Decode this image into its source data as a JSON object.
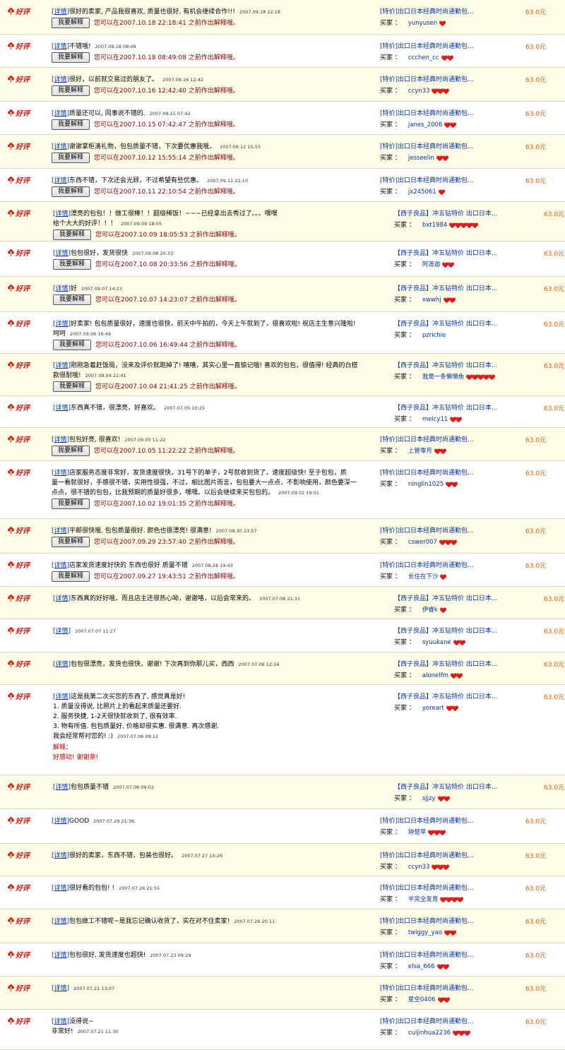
{
  "labels": {
    "rating": "好评",
    "detail": "详情",
    "explain_button": "我要解释",
    "notice_prefix": "您可以在",
    "notice_suffix": " 之前作出解释哦。",
    "buyer": "买家 ：",
    "explanation_title": "解释："
  },
  "colors": {
    "rating_red": "#e21010",
    "link_blue": "#0033aa",
    "notice_red": "#8b0000",
    "price_orange": "#e85c00",
    "row_shade": "#fffce8"
  },
  "reviews": [
    {
      "comment": "很好的卖家, 产品我很喜欢, 质量也很好, 有机会继续合作!!!",
      "date": "2007.09.18 22:18",
      "deadline": "2007.10.18 22:18:41",
      "tag": "[特价]",
      "item": "出口日本经典时尚通勤包...",
      "buyer": "yunyusen",
      "hearts": 1,
      "price": "63.0元"
    },
    {
      "comment": "不错哦!",
      "date": "2007.09.18 08:49",
      "deadline": "2007.10.18 08:49:08",
      "tag": "[特价]",
      "item": "出口日本经典时尚通勤包...",
      "buyer": "ccchen_cc",
      "hearts": 2,
      "price": "63.0元"
    },
    {
      "comment": "很好，以前就交易过的朋友了。",
      "date": "2007.09.16 12:42",
      "deadline": "2007.10.16 12:42:40",
      "tag": "[特价]",
      "item": "出口日本经典时尚通勤包...",
      "buyer": "ccyn33",
      "hearts": 3,
      "price": "63.0元"
    },
    {
      "comment": "质量还可以, 同事说不错的.",
      "date": "2007.09.15 07:42",
      "deadline": "2007.10.15 07:42:47",
      "tag": "[特价]",
      "item": "出口日本经典时尚通勤包...",
      "buyer": "janes_2006",
      "hearts": 2,
      "price": "63.0元"
    },
    {
      "comment": "谢谢掌柜滴礼物，包包质量不错，下次要优惠我哦，",
      "date": "2007.09.12 15:55",
      "deadline": "2007.10.12 15:55:14",
      "tag": "[特价]",
      "item": "出口日本经典时尚通勤包...",
      "buyer": "jesseelin",
      "hearts": 2,
      "price": "63.0元"
    },
    {
      "comment": "东西不错，下次还会光顾，不过希望有些优惠。",
      "date": "2007.09.11 22:10",
      "deadline": "2007.10.11 22:10:54",
      "tag": "[特价]",
      "item": "出口日本经典时尚通勤包...",
      "buyer": "jx245061",
      "hearts": 1,
      "price": "63.0元"
    },
    {
      "wide": true,
      "comment": "漂亮的包包！！做工很棒！！超级稀饭！~~~已经拿出去秀过了。。。嘿嘿",
      "comment2": "给个大大的好评！！！",
      "date": "2007.09.09 18:05",
      "deadline": "2007.10.09 18:05:53",
      "tag": "【西子良品】",
      "item": "冲五钻特价 出口日本...",
      "buyer": "bxt1984",
      "hearts": 5,
      "price": "63.0元"
    },
    {
      "wide": true,
      "comment": "包包很好，发货很快",
      "date": "2007.09.08 20:33",
      "deadline": "2007.10.08 20:33:56",
      "tag": "【西子良品】",
      "item": "冲五钻特价 出口日本...",
      "buyer": "阿莲迦",
      "hearts": 2,
      "price": "63.0元"
    },
    {
      "wide": true,
      "comment": "好",
      "date": "2007.09.07 14:23",
      "deadline": "2007.10.07 14:23:07",
      "tag": "【西子良品】",
      "item": "冲五钻特价 出口日本...",
      "buyer": "xwwhj",
      "hearts": 2,
      "price": "63.0元"
    },
    {
      "wide": true,
      "comment": "好卖家! 包包质量很好，速度也很快，前天中午拍的，今天上午就到了，很喜欢啦! 祝店主生意兴隆啦!",
      "comment2": "呵呵",
      "date": "2007.09.06 16:49",
      "deadline": "2007.10.06 16:49:44",
      "tag": "【西子良品】",
      "item": "冲五钻特价 出口日本...",
      "buyer": "pzrichie",
      "hearts": 0,
      "price": "63.0元"
    },
    {
      "wide": true,
      "comment": "刚刚急着赶饭局，没来及评价就跑掉了! 嘻嘻，其实心里一直惦记哦! 喜欢的包包，很值得! 经典的白搭",
      "comment2": "款很耐哦!",
      "date": "2007.09.04 21:41",
      "deadline": "2007.10.04 21:41:25",
      "tag": "【西子良品】",
      "item": "冲五钻特价 出口日本...",
      "buyer": "我是一条懒懒鱼",
      "hearts": 5,
      "price": "63.0元"
    },
    {
      "wide": true,
      "noButton": true,
      "comment": "东西真不错，很漂亮，好喜欢。",
      "date": "2007.07.05 10:25",
      "tag": "【西子良品】",
      "item": "冲五钻特价 出口日本...",
      "buyer": "meicy11",
      "hearts": 2,
      "price": "63.0元"
    },
    {
      "comment": "包包好亮, 很喜欢!",
      "date": "2007.09.05 11:22",
      "deadline": "2007.10.05 11:22:22",
      "tag": "[特价]",
      "item": "出口日本经典时尚通勤包...",
      "buyer": "上管零月",
      "hearts": 2,
      "price": "63.0元"
    },
    {
      "comment": "店家服务态度非常好，发货速度很快，31号下的单子，2号就收到货了，速度超级快! 至于包包，质",
      "comment2": "量一看就很好，手感很不错，实用性很强，不过，相比图片而言，包包要大一点点，不影响使用，颜色要深一",
      "comment3": "点点，很不错的包包，比我预期的质量好很多，嘿嘿。以后会继续来买包包的。",
      "date": "2007.09.02 19:01",
      "deadline": "2007.10.02 19:01:35",
      "tag": "[特价]",
      "item": "出口日本经典时尚通勤包...",
      "buyer": "ninglin1025",
      "hearts": 2,
      "price": "63.0元"
    },
    {
      "comment": "平邮很快哦. 包包质量很好. 颜色也很漂亮! 很满意!",
      "date": "2007.08.30 23:57",
      "deadline": "2007.09.29 23:57:40",
      "tag": "[特价]",
      "item": "出口日本经典时尚通勤包...",
      "buyer": "cswer007",
      "hearts": 3,
      "price": "63.0元"
    },
    {
      "comment": "店家发货速度好快的 东西也很好 质量不错",
      "date": "2007.08.28 19:43",
      "deadline": "2007.09.27 19:43:51",
      "tag": "[特价]",
      "item": "出口日本经典时尚通勤包...",
      "buyer": "长住在下沙",
      "hearts": 1,
      "price": "63.0元"
    },
    {
      "wide": true,
      "noButton": true,
      "comment": "东西真的好好哦，而且店主还很热心呦，谢谢咯，以后会常来的。",
      "date": "2007.07.08 21:31",
      "tag": "【西子良品】",
      "item": "冲五钻特价 出口日本...",
      "buyer": "伊睿k",
      "hearts": 1,
      "price": "63.0元"
    },
    {
      "wide": true,
      "noButton": true,
      "comment": "",
      "date": "2007.07.07 11:27",
      "tag": "【西子良品】",
      "item": "冲五钻特价 出口日本...",
      "buyer": "syuukane",
      "hearts": 2,
      "price": "63.0元"
    },
    {
      "wide": true,
      "noButton": true,
      "comment": "包包很漂亮，发货也很快，谢谢! 下次再到你那儿买，西西",
      "date": "2007.07.06 12:16",
      "tag": "【西子良品】",
      "item": "冲五钻特价 出口日本...",
      "buyer": "alonelfm",
      "hearts": 2,
      "price": "63.0元"
    },
    {
      "wide": true,
      "noButton": true,
      "comment": "这是我第二次买您的东西了, 感觉真是好!",
      "comment2": "1. 质量没得说, 比照片上的看起来质量还要好.",
      "comment3": "2. 服务快捷, 1-2天很快就收到了, 很有效率.",
      "comment4": "3. 物有所值. 包包质量好, 价格却很实惠. 很满意. 再次感谢.",
      "comment5": "我会经常帮衬您的! :)",
      "date": "2007.07.06 09:12",
      "explanation": "好感动! 谢谢亲!",
      "tag": "【西子良品】",
      "item": "冲五钻特价 出口日本...",
      "buyer": "yoreart",
      "hearts": 2,
      "price": "63.0元"
    },
    {
      "wide": true,
      "noButton": true,
      "comment": "包包质量不错",
      "date": "2007.07.06 09:02",
      "tag": "【西子良品】",
      "item": "冲五钻特价 出口日本...",
      "buyer": "sjjzy",
      "hearts": 2,
      "price": "63.0元"
    },
    {
      "noButton": true,
      "comment": "GOOD",
      "date": "2007.07.29 21:36",
      "tag": "[特价]",
      "item": "出口日本经典时尚通勤包...",
      "buyer": "钟楚苹",
      "hearts": 3,
      "price": "63.0元"
    },
    {
      "noButton": true,
      "comment": "很好的卖家，东西不错，包装也很好。",
      "date": "2007.07.27 10:26",
      "tag": "[特价]",
      "item": "出口日本经典时尚通勤包...",
      "buyer": "ccyn33",
      "hearts": 3,
      "price": "63.0元"
    },
    {
      "noButton": true,
      "comment": "很好看的包包! !",
      "date": "2007.07.26 21:55",
      "tag": "[特价]",
      "item": "出口日本经典时尚通勤包...",
      "buyer": "半完全发育",
      "hearts": 4,
      "price": "63.0元"
    },
    {
      "noButton": true,
      "comment": "包包做工不错呢~是我忘记确认收货了，实在对不住卖家!",
      "date": "2007.07.26 20:11",
      "tag": "[特价]",
      "item": "出口日本经典时尚通勤包...",
      "buyer": "twiggy_yao",
      "hearts": 2,
      "price": "63.0元"
    },
    {
      "noButton": true,
      "comment": "包包很好, 发货速度也超快!",
      "date": "2007.07.23 09:29",
      "tag": "[特价]",
      "item": "出口日本经典时尚通勤包...",
      "buyer": "elsa_666",
      "hearts": 2,
      "price": "63.0元"
    },
    {
      "noButton": true,
      "comment": "",
      "date": "2007.07.21 13:07",
      "tag": "[特价]",
      "item": "出口日本经典时尚通勤包...",
      "buyer": "星空0406",
      "hearts": 2,
      "price": "63.0元"
    },
    {
      "noButton": true,
      "comment": "没得说~",
      "comment2": "非常好!",
      "date": "2007.07.21 11:30",
      "tag": "[特价]",
      "item": "出口日本经典时尚通勤包...",
      "buyer": "cuijinhua2236",
      "hearts": 3,
      "price": "63.0元"
    }
  ]
}
